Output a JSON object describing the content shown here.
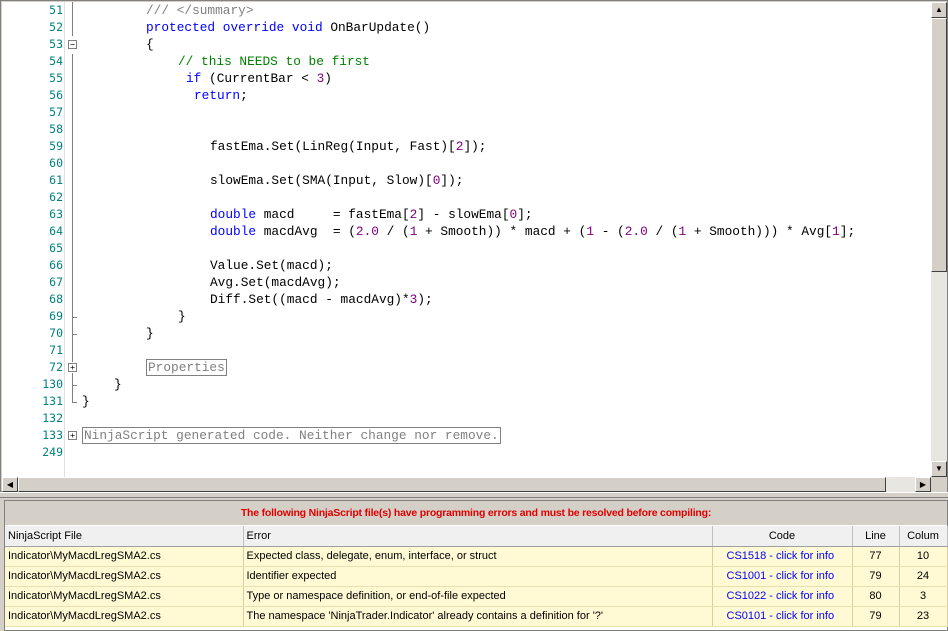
{
  "editor": {
    "lines": [
      {
        "num": "51",
        "indent": 144,
        "tokens": [
          {
            "t": "/// </summary>",
            "c": "cmgray"
          }
        ]
      },
      {
        "num": "52",
        "indent": 144,
        "tokens": [
          {
            "t": "protected override void",
            "c": "kw"
          },
          {
            "t": " OnBarUpdate()",
            "c": ""
          }
        ]
      },
      {
        "num": "53",
        "indent": 144,
        "tokens": [
          {
            "t": "{",
            "c": ""
          }
        ],
        "fold": "minus"
      },
      {
        "num": "54",
        "indent": 176,
        "tokens": [
          {
            "t": "// this NEEDS to be first",
            "c": "cm"
          }
        ]
      },
      {
        "num": "55",
        "indent": 184,
        "tokens": [
          {
            "t": "if",
            "c": "kw"
          },
          {
            "t": " (CurrentBar < ",
            "c": ""
          },
          {
            "t": "3",
            "c": "num"
          },
          {
            "t": ")",
            "c": ""
          }
        ]
      },
      {
        "num": "56",
        "indent": 192,
        "tokens": [
          {
            "t": "return",
            "c": "kw"
          },
          {
            "t": ";",
            "c": ""
          }
        ]
      },
      {
        "num": "57",
        "indent": 208,
        "tokens": []
      },
      {
        "num": "58",
        "indent": 208,
        "tokens": []
      },
      {
        "num": "59",
        "indent": 208,
        "tokens": [
          {
            "t": "fastEma.Set(LinReg(Input, Fast)[",
            "c": ""
          },
          {
            "t": "2",
            "c": "num"
          },
          {
            "t": "]);",
            "c": ""
          }
        ]
      },
      {
        "num": "60",
        "indent": 208,
        "tokens": []
      },
      {
        "num": "61",
        "indent": 208,
        "tokens": [
          {
            "t": "slowEma.Set(SMA(Input, Slow)[",
            "c": ""
          },
          {
            "t": "0",
            "c": "num"
          },
          {
            "t": "]);",
            "c": ""
          }
        ]
      },
      {
        "num": "62",
        "indent": 208,
        "tokens": []
      },
      {
        "num": "63",
        "indent": 208,
        "tokens": [
          {
            "t": "double",
            "c": "kw"
          },
          {
            "t": " macd     = fastEma[",
            "c": ""
          },
          {
            "t": "2",
            "c": "num"
          },
          {
            "t": "] - slowEma[",
            "c": ""
          },
          {
            "t": "0",
            "c": "num"
          },
          {
            "t": "];",
            "c": ""
          }
        ]
      },
      {
        "num": "64",
        "indent": 208,
        "tokens": [
          {
            "t": "double",
            "c": "kw"
          },
          {
            "t": " macdAvg  = (",
            "c": ""
          },
          {
            "t": "2.0",
            "c": "num"
          },
          {
            "t": " / (",
            "c": ""
          },
          {
            "t": "1",
            "c": "num"
          },
          {
            "t": " + Smooth)) * macd + (",
            "c": ""
          },
          {
            "t": "1",
            "c": "num"
          },
          {
            "t": " - (",
            "c": ""
          },
          {
            "t": "2.0",
            "c": "num"
          },
          {
            "t": " / (",
            "c": ""
          },
          {
            "t": "1",
            "c": "num"
          },
          {
            "t": " + Smooth))) * Avg[",
            "c": ""
          },
          {
            "t": "1",
            "c": "num"
          },
          {
            "t": "];",
            "c": ""
          }
        ]
      },
      {
        "num": "65",
        "indent": 208,
        "tokens": []
      },
      {
        "num": "66",
        "indent": 208,
        "tokens": [
          {
            "t": "Value.Set(macd);",
            "c": ""
          }
        ]
      },
      {
        "num": "67",
        "indent": 208,
        "tokens": [
          {
            "t": "Avg.Set(macdAvg);",
            "c": ""
          }
        ]
      },
      {
        "num": "68",
        "indent": 208,
        "tokens": [
          {
            "t": "Diff.Set((macd - macdAvg)*",
            "c": ""
          },
          {
            "t": "3",
            "c": "num"
          },
          {
            "t": ");",
            "c": ""
          }
        ]
      },
      {
        "num": "69",
        "indent": 176,
        "tokens": [
          {
            "t": "}",
            "c": ""
          }
        ]
      },
      {
        "num": "70",
        "indent": 144,
        "tokens": [
          {
            "t": "}",
            "c": ""
          }
        ]
      },
      {
        "num": "71",
        "indent": 144,
        "tokens": []
      },
      {
        "num": "72",
        "indent": 144,
        "tokens": [
          {
            "t": "Properties",
            "c": "region"
          }
        ],
        "fold": "plus"
      },
      {
        "num": "130",
        "indent": 112,
        "tokens": [
          {
            "t": "}",
            "c": ""
          }
        ]
      },
      {
        "num": "131",
        "indent": 80,
        "tokens": [
          {
            "t": "}",
            "c": ""
          }
        ]
      },
      {
        "num": "132",
        "indent": 80,
        "tokens": []
      },
      {
        "num": "133",
        "indent": 80,
        "tokens": [
          {
            "t": "NinjaScript generated code. Neither change nor remove.",
            "c": "region"
          }
        ],
        "fold": "plus"
      },
      {
        "num": "249",
        "indent": 80,
        "tokens": []
      }
    ]
  },
  "errors": {
    "banner": "The following NinjaScript file(s) have programming errors and must be resolved before compiling:",
    "columns": [
      "NinjaScript File",
      "Error",
      "Code",
      "Line",
      "Colum"
    ],
    "rows": [
      {
        "file": "Indicator\\MyMacdLregSMA2.cs",
        "error": "Expected class, delegate, enum, interface, or struct",
        "code": "CS1518 - click for info",
        "line": "77",
        "col": "10"
      },
      {
        "file": "Indicator\\MyMacdLregSMA2.cs",
        "error": "Identifier expected",
        "code": "CS1001 - click for info",
        "line": "79",
        "col": "24"
      },
      {
        "file": "Indicator\\MyMacdLregSMA2.cs",
        "error": "Type or namespace definition, or end-of-file expected",
        "code": "CS1022 - click for info",
        "line": "80",
        "col": "3"
      },
      {
        "file": "Indicator\\MyMacdLregSMA2.cs",
        "error": "The namespace 'NinjaTrader.Indicator' already contains a definition for '?'",
        "code": "CS0101 - click for info",
        "line": "79",
        "col": "23"
      }
    ]
  },
  "colors": {
    "keyword": "#0000ff",
    "comment": "#008000",
    "number": "#800080",
    "error_banner": "#e00000",
    "row_bg": "#fffad4"
  },
  "icons": {
    "scroll_up": "arrow-up-icon",
    "scroll_down": "arrow-down-icon",
    "scroll_left": "arrow-left-icon",
    "scroll_right": "arrow-right-icon"
  }
}
